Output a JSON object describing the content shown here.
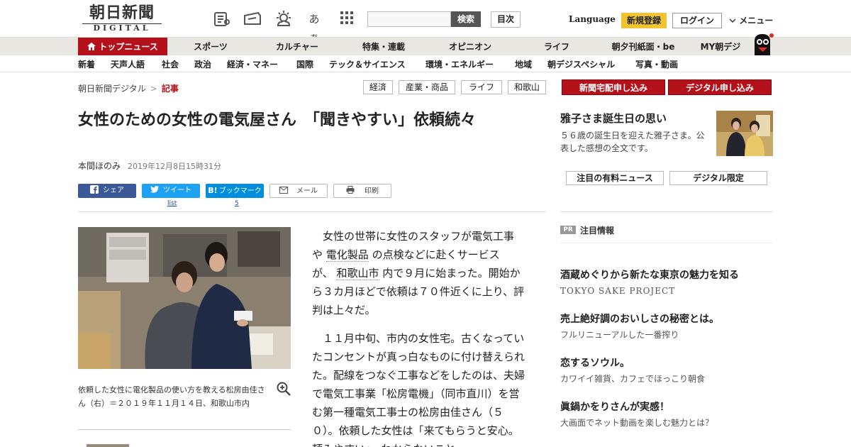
{
  "header": {
    "logo_main": "朝日新聞",
    "logo_sub": "DIGITAL",
    "search_button": "検索",
    "search_placeholder": "",
    "toc_button": "目次",
    "language": "Language",
    "signup": "新規登録",
    "login": "ログイン",
    "menu": "メニュー",
    "font_size_icon_text": "あぁ"
  },
  "categories": [
    "トップニュース",
    "スポーツ",
    "カルチャー",
    "特集・連載",
    "オピニオン",
    "ライフ",
    "朝夕刊紙面・be",
    "MY朝デジ"
  ],
  "subnav": [
    "新着",
    "天声人語",
    "社会",
    "政治",
    "経済・マネー",
    "国際",
    "テック＆サイエンス",
    "環境・エネルギー",
    "地域",
    "朝デジスペシャル",
    "写真・動画"
  ],
  "breadcrumb": {
    "home": "朝日新聞デジタル",
    "sep": ">",
    "current": "記事"
  },
  "tags": [
    "経済",
    "産業・商品",
    "ライフ",
    "和歌山"
  ],
  "article": {
    "headline": "女性のための女性の電気屋さん　「聞きやすい」依頼続々",
    "author": "本間ほのみ",
    "date": "2019年12月8日15時31分",
    "share": {
      "facebook": "シェア",
      "twitter": "ツイート",
      "hatena": "ブックマーク",
      "mail": "メール",
      "print": "印刷",
      "twitter_count": "list",
      "hatena_count": "5"
    },
    "caption": "依頼した女性に電化製品の使い方を教える松房由佳さん（右）＝２０１９年１１月１４日、和歌山市内",
    "para1_a": "女性の世帯に女性のスタッフが電気工事や",
    "para1_link1": "電化製品",
    "para1_b": "の点検などに赴くサービスが、",
    "para1_link2": "和歌山市",
    "para1_c": "内で９月に始まった。開始から３カ月ほどで依頼は７０件近くに上り、評判は上々だ。",
    "para2": "１１月中旬、市内の女性宅。古くなっていたコンセントが真っ白なものに付け替えられた。配線をつなぐ工事などをしたのは、夫婦で電気工事業「松房電機」（同市直川）を営む第一種電気工事士の松房由佳さん（５０）。依頼した女性は「来てもらうと安心。頼みやすい」。わからないこと"
  },
  "sidebar": {
    "btn_paper": "新聞宅配申し込み",
    "btn_digital": "デジタル申し込み",
    "feature_title": "雅子さま誕生日の思い",
    "feature_desc": "５６歳の誕生日を迎えた雅子さま。公表した感想の全文です。",
    "btn_paid_news": "注目の有料ニュース",
    "btn_digital_only": "デジタル限定",
    "pr_badge": "PR",
    "pr_heading": "注目情報",
    "pr_items": [
      {
        "title": "酒蔵めぐりから新たな東京の魅力を知る",
        "sub": "TOKYO SAKE PROJECT"
      },
      {
        "title": "売上絶好調のおいしさの秘密とは。",
        "sub": "フルリニューアルした一番搾り"
      },
      {
        "title": "恋するソウル。",
        "sub": "カワイイ雑貨、カフェでほっこり朝食"
      },
      {
        "title": "眞鍋かをりさんが実感！",
        "sub": "大画面でネット動画を楽しむ魅力とは？"
      }
    ]
  },
  "colors": {
    "brand_red": "#b5111b",
    "signup_yellow": "#f3c431",
    "facebook": "#3b5998",
    "twitter": "#1da1f2",
    "hatena": "#008fde"
  }
}
